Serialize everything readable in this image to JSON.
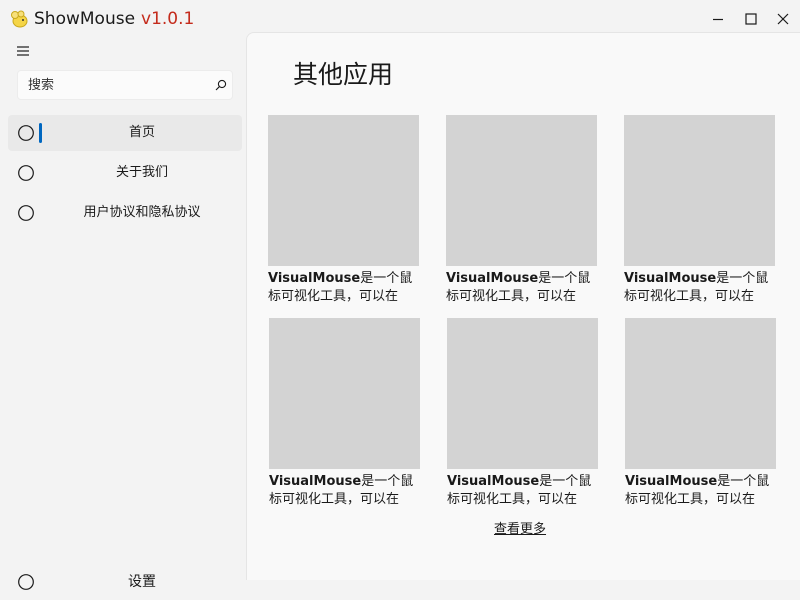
{
  "titlebar": {
    "app_name": "ShowMouse",
    "version": "v1.0.1",
    "app_icon": "yellow-mouse-icon",
    "minimize_icon": "minimize-icon",
    "maximize_icon": "maximize-icon",
    "close_icon": "close-icon"
  },
  "sidebar": {
    "menu_icon": "hamburger-menu-icon",
    "search": {
      "placeholder": "搜索",
      "value": "",
      "icon": "search-icon"
    },
    "items": [
      {
        "label": "首页",
        "icon": "circle-icon",
        "selected": true
      },
      {
        "label": "关于我们",
        "icon": "circle-icon",
        "selected": false
      },
      {
        "label": "用户协议和隐私协议",
        "icon": "circle-icon",
        "selected": false
      }
    ],
    "settings": {
      "label": "设置",
      "icon": "circle-icon"
    }
  },
  "main": {
    "title": "其他应用",
    "cards": [
      {
        "brand": "VisualMouse",
        "text": "是一个鼠标可视化工具，可以在"
      },
      {
        "brand": "VisualMouse",
        "text": "是一个鼠标可视化工具，可以在"
      },
      {
        "brand": "VisualMouse",
        "text": "是一个鼠标可视化工具，可以在"
      },
      {
        "brand": "VisualMouse",
        "text": "是一个鼠标可视化工具，可以在"
      },
      {
        "brand": "VisualMouse",
        "text": "是一个鼠标可视化工具，可以在"
      },
      {
        "brand": "VisualMouse",
        "text": "是一个鼠标可视化工具，可以在"
      }
    ],
    "more_label": "查看更多"
  },
  "colors": {
    "accent": "#0067c0",
    "version": "#c42b1c",
    "thumbnail": "#d3d3d3",
    "selected_bg": "#e9e9e9"
  }
}
